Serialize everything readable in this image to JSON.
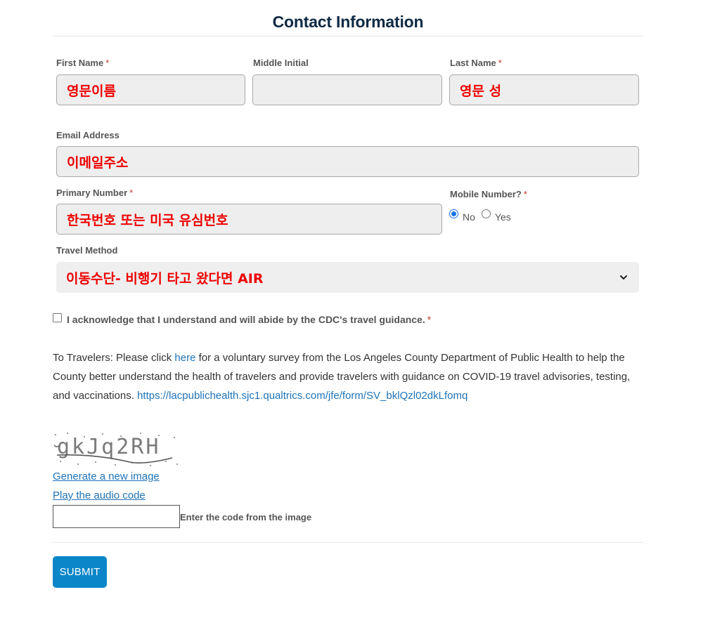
{
  "form": {
    "title": "Contact Information",
    "first_name": {
      "label": "First Name",
      "required": "*",
      "value": "영문이름"
    },
    "middle_initial": {
      "label": "Middle Initial",
      "value": ""
    },
    "last_name": {
      "label": "Last Name",
      "required": "*",
      "value": "영문 성"
    },
    "email": {
      "label": "Email Address",
      "value": "이메일주소"
    },
    "primary_number": {
      "label": "Primary Number",
      "required": "*",
      "value": "한국번호 또는 미국 유심번호"
    },
    "mobile_number": {
      "label": "Mobile Number?",
      "required": "*",
      "options": [
        {
          "label": "No",
          "selected": true
        },
        {
          "label": "Yes",
          "selected": false
        }
      ]
    },
    "travel_method": {
      "label": "Travel Method",
      "selected_value": "이동수단- 비행기 타고 왔다면 AIR"
    },
    "acknowledge": {
      "label": "I acknowledge that I understand and will abide by the CDC's travel guidance.",
      "required": "*",
      "checked": false
    }
  },
  "survey": {
    "prefix": "To Travelers: Please click ",
    "link_text": "here",
    "middle": " for a voluntary survey from the Los Angeles County Department of Public Health to help the County better understand the health of travelers and provide travelers with guidance on COVID-19 travel advisories, testing, and vaccinations. ",
    "url": "https://lacpublichealth.sjc1.qualtrics.com/jfe/form/SV_bklQzl02dkLfomq"
  },
  "captcha": {
    "code_text": "gkJq2RH",
    "generate_link": "Generate a new image",
    "audio_link": "Play the audio code",
    "input_value": "",
    "input_label": "Enter the code from the image"
  },
  "submit_label": "SUBMIT",
  "colors": {
    "accent": "#0b87c9",
    "link": "#1f73b7",
    "title": "#0f2a44",
    "required": "#c0392b",
    "field_text": "#ee0000"
  }
}
